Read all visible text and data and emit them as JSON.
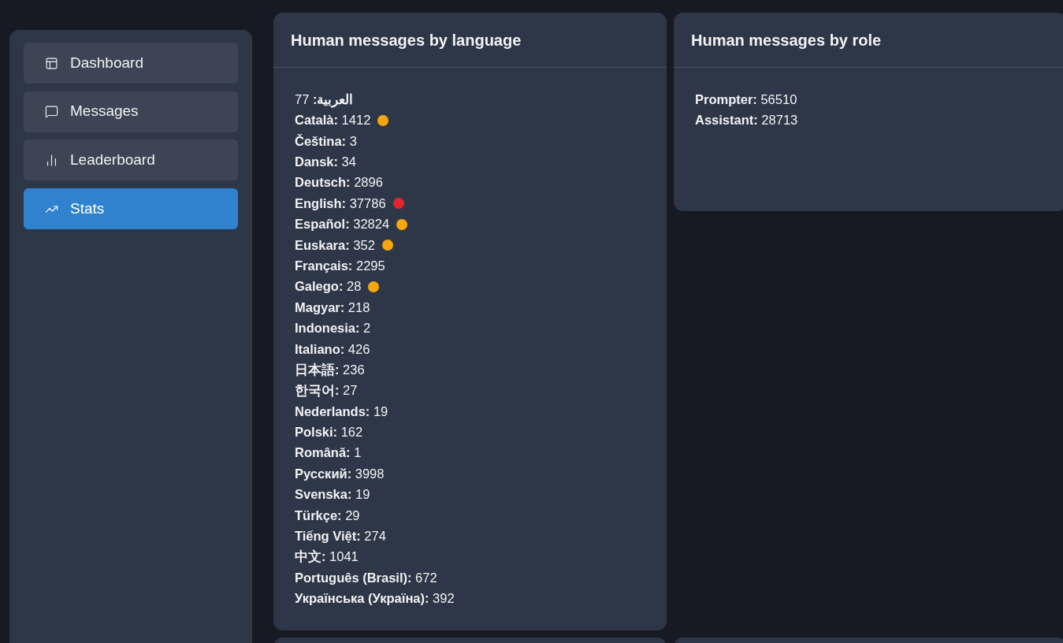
{
  "sidebar": {
    "items": [
      {
        "label": "Dashboard",
        "selected": false
      },
      {
        "label": "Messages",
        "selected": false
      },
      {
        "label": "Leaderboard",
        "selected": false
      },
      {
        "label": "Stats",
        "selected": true
      }
    ]
  },
  "cards": [
    {
      "title": "Human messages by language",
      "rows": [
        {
          "text": "**العربية:** 77"
        },
        {
          "text": "**Català:** 1412",
          "color": "#f8a70b"
        },
        {
          "text": "**Čeština:** 3"
        },
        {
          "text": "**Dansk:** 34"
        },
        {
          "text": "**Deutsch:** 2896"
        },
        {
          "text": "**English:** 37786",
          "color": "#e3242b"
        },
        {
          "text": "**Español:** 32824",
          "color": "#f8a70b"
        },
        {
          "text": "**Euskara:** 352",
          "color": "#f8a70b"
        },
        {
          "text": "**Français:** 2295"
        },
        {
          "text": "**Galego:** 28",
          "color": "#f8a70b"
        },
        {
          "text": "**Magyar:** 218"
        },
        {
          "text": "**Indonesia:** 2"
        },
        {
          "text": "**Italiano:** 426"
        },
        {
          "text": "**日本語:** 236"
        },
        {
          "text": "**한국어:** 27"
        },
        {
          "text": "**Nederlands:** 19"
        },
        {
          "text": "**Polski:** 162"
        },
        {
          "text": "**Română:** 1"
        },
        {
          "text": "**Русский:** 3998"
        },
        {
          "text": "**Svenska:** 19"
        },
        {
          "text": "**Türkçe:** 29"
        },
        {
          "text": "**Tiếng Việt:** 274"
        },
        {
          "text": "**中文:** 1041"
        },
        {
          "text": "**Português (Brasil):** 672"
        },
        {
          "text": "**Українська (Україна):** 392"
        }
      ]
    },
    {
      "title": "Human messages by role",
      "rows": [
        {
          "text": "**Prompter:** 56510"
        },
        {
          "text": "**Assistant:** 28713"
        }
      ]
    }
  ]
}
